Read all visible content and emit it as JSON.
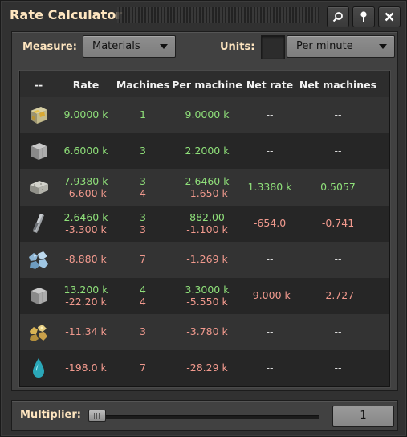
{
  "window": {
    "title": "Rate Calculator"
  },
  "titlebar_buttons": [
    {
      "name": "search-button",
      "icon": "search-icon"
    },
    {
      "name": "pin-button",
      "icon": "pin-icon"
    },
    {
      "name": "close-button",
      "icon": "close-icon"
    }
  ],
  "controls": {
    "measure_label": "Measure:",
    "measure_value": "Materials",
    "units_label": "Units:",
    "units_value": "Per minute"
  },
  "table": {
    "headers": [
      "--",
      "Rate",
      "Machines",
      "Per machine",
      "Net rate",
      "Net machines"
    ],
    "rows": [
      {
        "icon": "gold-plate-icon",
        "rate": [
          {
            "v": "9.0000 k",
            "s": "pos"
          }
        ],
        "machines": [
          {
            "v": "1",
            "s": "pos"
          }
        ],
        "per_machine": [
          {
            "v": "9.0000 k",
            "s": "pos"
          }
        ],
        "net_rate": {
          "v": "--",
          "s": "neu"
        },
        "net_machines": {
          "v": "--",
          "s": "neu"
        }
      },
      {
        "icon": "steel-block-icon",
        "rate": [
          {
            "v": "6.6000 k",
            "s": "pos"
          }
        ],
        "machines": [
          {
            "v": "3",
            "s": "pos"
          }
        ],
        "per_machine": [
          {
            "v": "2.2000 k",
            "s": "pos"
          }
        ],
        "net_rate": {
          "v": "--",
          "s": "neu"
        },
        "net_machines": {
          "v": "--",
          "s": "neu"
        }
      },
      {
        "icon": "stone-brick-icon",
        "rate": [
          {
            "v": "7.9380 k",
            "s": "pos"
          },
          {
            "v": "-6.600 k",
            "s": "neg"
          }
        ],
        "machines": [
          {
            "v": "3",
            "s": "pos"
          },
          {
            "v": "4",
            "s": "neg"
          }
        ],
        "per_machine": [
          {
            "v": "2.6460 k",
            "s": "pos"
          },
          {
            "v": "-1.650 k",
            "s": "neg"
          }
        ],
        "net_rate": {
          "v": "1.3380 k",
          "s": "pos"
        },
        "net_machines": {
          "v": "0.5057",
          "s": "pos"
        }
      },
      {
        "icon": "steel-beam-icon",
        "rate": [
          {
            "v": "2.6460 k",
            "s": "pos"
          },
          {
            "v": "-3.300 k",
            "s": "neg"
          }
        ],
        "machines": [
          {
            "v": "3",
            "s": "pos"
          },
          {
            "v": "3",
            "s": "neg"
          }
        ],
        "per_machine": [
          {
            "v": "882.00",
            "s": "pos"
          },
          {
            "v": "-1.100 k",
            "s": "neg"
          }
        ],
        "net_rate": {
          "v": "-654.0",
          "s": "neg"
        },
        "net_machines": {
          "v": "-0.741",
          "s": "neg"
        }
      },
      {
        "icon": "blue-ore-icon",
        "rate": [
          {
            "v": "-8.880 k",
            "s": "neg"
          }
        ],
        "machines": [
          {
            "v": "7",
            "s": "neg"
          }
        ],
        "per_machine": [
          {
            "v": "-1.269 k",
            "s": "neg"
          }
        ],
        "net_rate": {
          "v": "--",
          "s": "neu"
        },
        "net_machines": {
          "v": "--",
          "s": "neu"
        }
      },
      {
        "icon": "steel-block-icon",
        "rate": [
          {
            "v": "13.200 k",
            "s": "pos"
          },
          {
            "v": "-22.20 k",
            "s": "neg"
          }
        ],
        "machines": [
          {
            "v": "4",
            "s": "pos"
          },
          {
            "v": "4",
            "s": "neg"
          }
        ],
        "per_machine": [
          {
            "v": "3.3000 k",
            "s": "pos"
          },
          {
            "v": "-5.550 k",
            "s": "neg"
          }
        ],
        "net_rate": {
          "v": "-9.000 k",
          "s": "neg"
        },
        "net_machines": {
          "v": "-2.727",
          "s": "neg"
        }
      },
      {
        "icon": "gold-ore-icon",
        "rate": [
          {
            "v": "-11.34 k",
            "s": "neg"
          }
        ],
        "machines": [
          {
            "v": "3",
            "s": "neg"
          }
        ],
        "per_machine": [
          {
            "v": "-3.780 k",
            "s": "neg"
          }
        ],
        "net_rate": {
          "v": "--",
          "s": "neu"
        },
        "net_machines": {
          "v": "--",
          "s": "neu"
        }
      },
      {
        "icon": "water-drop-icon",
        "rate": [
          {
            "v": "-198.0 k",
            "s": "neg"
          }
        ],
        "machines": [
          {
            "v": "7",
            "s": "neg"
          }
        ],
        "per_machine": [
          {
            "v": "-28.29 k",
            "s": "neg"
          }
        ],
        "net_rate": {
          "v": "--",
          "s": "neu"
        },
        "net_machines": {
          "v": "--",
          "s": "neu"
        }
      }
    ]
  },
  "footer": {
    "multiplier_label": "Multiplier:",
    "multiplier_value": "1"
  },
  "colors": {
    "positive": "#8fe07a",
    "negative": "#f29a8e",
    "neutral": "#dcdcdc",
    "heading": "#ffe6c0"
  }
}
